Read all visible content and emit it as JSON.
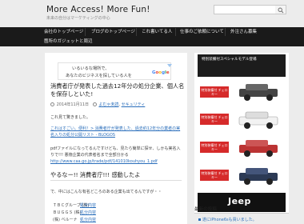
{
  "site": {
    "title": "More Access! More Fun!",
    "tagline": "未来の自分はマーケティングの中心"
  },
  "search": {
    "placeholder": ""
  },
  "nav": {
    "items": [
      "会社のトップページ",
      "ブログのトップページ",
      "これ書いてる人",
      "仕事のご依頼について",
      "外注さん募集",
      "箇所のガジェットと周辺"
    ]
  },
  "ad": {
    "line1": "いるいるな場所で、",
    "line2": "あなたのビジネスを探している人を",
    "logo": "Google"
  },
  "post": {
    "title": "消費者庁が発表した過去12年分の処分企業、個人名を保存しといた!",
    "date": "2014年11月11日",
    "categories": [
      "よむゃ未読",
      "セキュリティ"
    ],
    "intro": "これ見て驚きました。",
    "link1": "これはすごい。便利！> 消費者庁が発表した、過去約12年分の業者の実",
    "link2": "名入りの処分公開リスト - BLOGOS",
    "pdf_note1": "pdfファイルになってるんですけども、見たら簡単に探せ、しかも実名入",
    "pdf_note2": "りで!!! 悪徳企業の代表者名まで全部分かる",
    "pdf_url": "http://www.caa.go.jp/trade/pdf/141010kouhyou_1.pdf",
    "section_heading": "やるなー!! 消費者庁!!! 感動したよ",
    "section_intro": "で、中にはこんな有名どころのある企業も出てるんですが・・",
    "list": [
      {
        "label": "ＴＢＣグループ (株)",
        "value": "処分内容"
      },
      {
        "label": "ＢＵＧＧＳ (株)",
        "value": "処分内容"
      },
      {
        "label": "(株) ベルーナ",
        "value": "処分内容"
      }
    ]
  },
  "sidebar_ad": {
    "top_text": "特別装備付スペシャルモデル登場",
    "badges": [
      "特別装備付 チェロキー",
      "特別装備付 チェロキー",
      "特別装備付 チェロキー",
      "特別装備付 チェロキー"
    ],
    "brand": "Jeep"
  },
  "sidebar": {
    "recent_heading": "最新の投稿",
    "recent_post": "遂にiPhone6sも買いました。"
  },
  "colors": {
    "nav_bg": "#1a1a1a",
    "link": "#2a6ebb",
    "badge": "#d62a2a",
    "page_bg": "#ececec"
  }
}
